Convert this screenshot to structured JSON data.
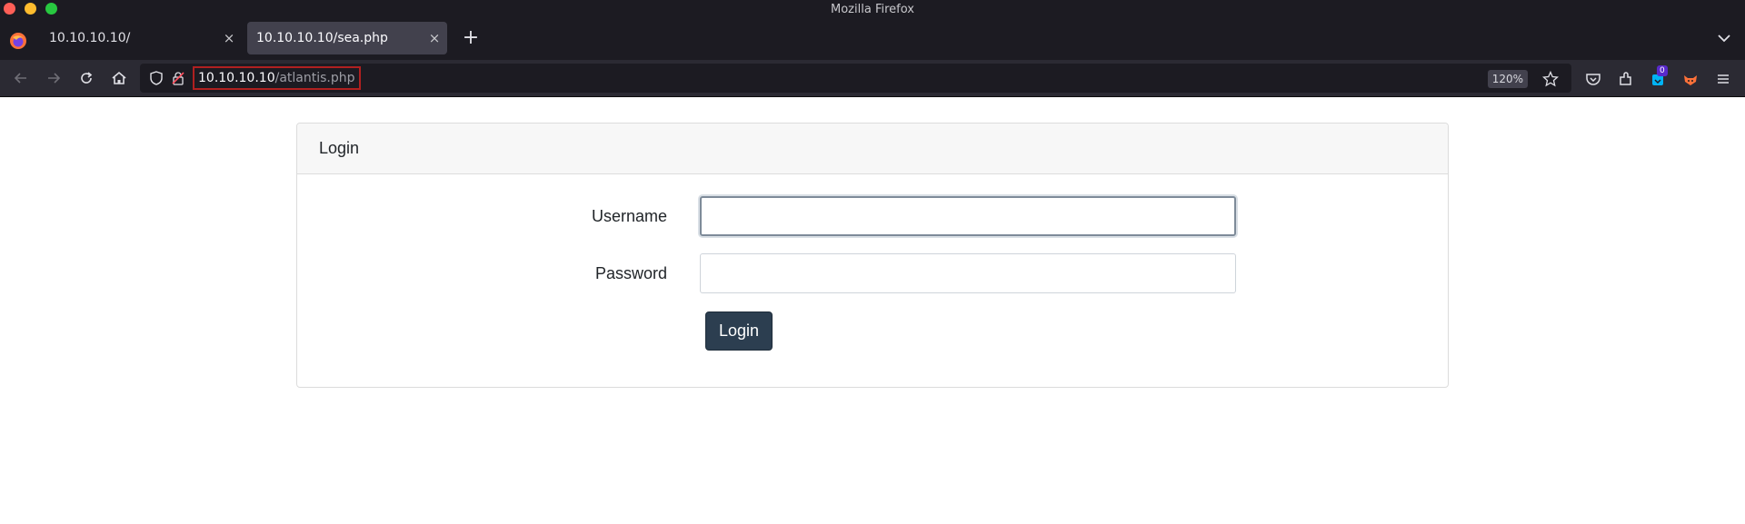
{
  "window": {
    "title": "Mozilla Firefox"
  },
  "tabs": [
    {
      "label": "10.10.10.10/",
      "active": false
    },
    {
      "label": "10.10.10.10/sea.php",
      "active": true
    }
  ],
  "newtab_symbol": "+",
  "close_symbol": "×",
  "urlbar": {
    "host": "10.10.10.10",
    "path": "/atlantis.php",
    "zoom": "120%"
  },
  "toolbar": {
    "badge_count": "0"
  },
  "icons": [
    "firefox-logo",
    "back",
    "forward",
    "reload",
    "home",
    "shield",
    "lock",
    "star",
    "pocket",
    "extensions",
    "container",
    "firefox-fox",
    "menu",
    "chevron-down"
  ],
  "page": {
    "card_title": "Login",
    "username_label": "Username",
    "password_label": "Password",
    "login_button": "Login",
    "username_value": "",
    "password_value": ""
  },
  "colors": {
    "button_bg": "#2c3e50",
    "url_highlight_border": "#b02020"
  }
}
